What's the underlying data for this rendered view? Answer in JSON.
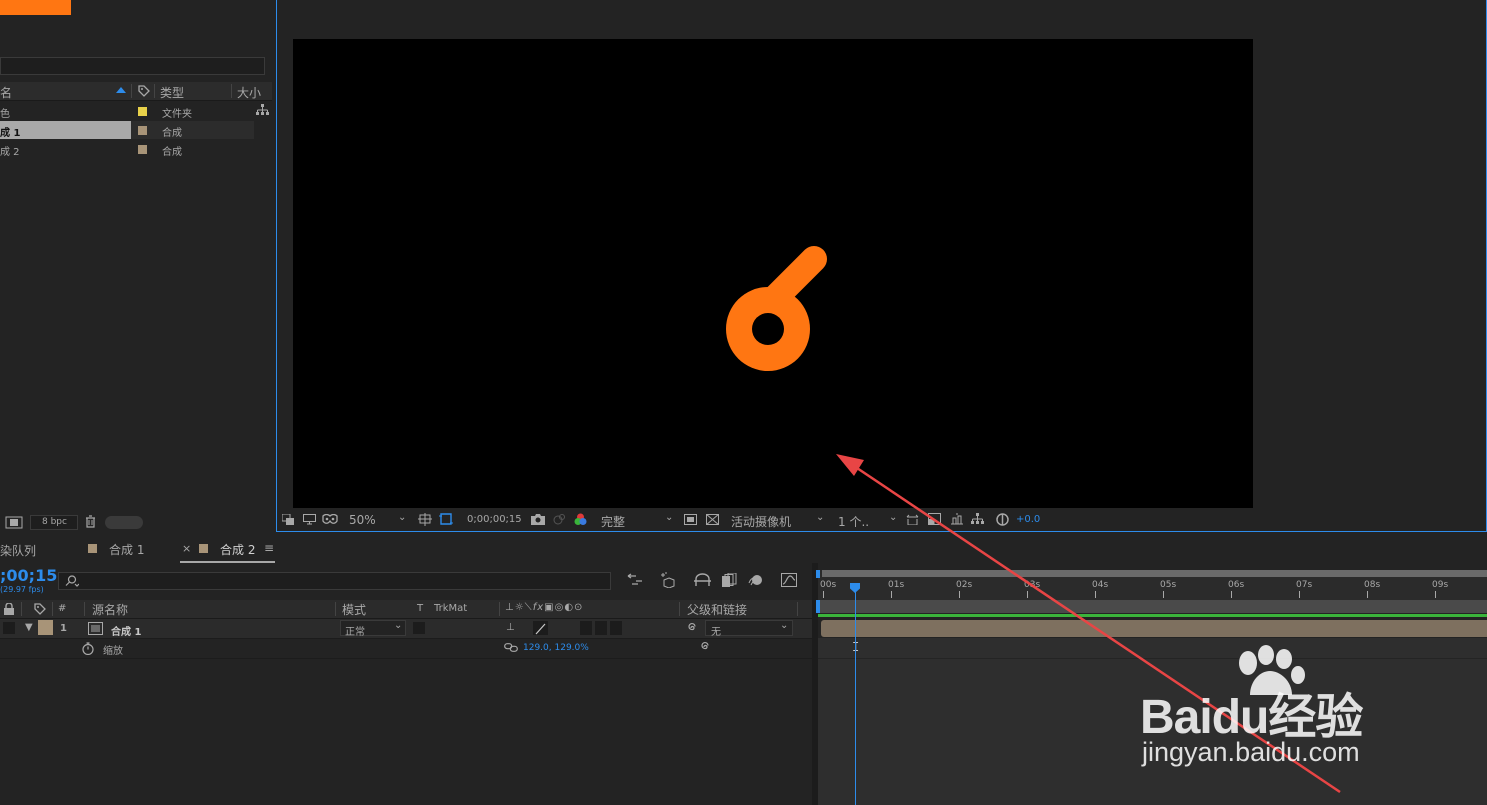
{
  "colors": {
    "accent": "#2d8ceb",
    "orange": "#ff7612",
    "folder": "#e8d14a",
    "comp": "#a89478",
    "green": "#3bb43b"
  },
  "project": {
    "columns": {
      "name": "名",
      "type": "类型",
      "size": "大小"
    },
    "items": [
      {
        "name": "色",
        "type": "文件夹"
      },
      {
        "name": "成 1",
        "type": "合成"
      },
      {
        "name": "成 2",
        "type": "合成"
      }
    ],
    "bpc": "8 bpc"
  },
  "viewer": {
    "zoom": "50%",
    "timecode": "0;00;00;15",
    "resolution": "完整",
    "camera": "活动摄像机",
    "views": "1 个..",
    "exposure": "+0.0"
  },
  "tabs": {
    "render_queue": "染队列",
    "comp1": "合成 1",
    "comp2": "合成 2",
    "close": "×",
    "menu": "≡"
  },
  "timeline": {
    "timecode": ";00;15",
    "fps": "(29.97 fps)",
    "search_placeholder": "",
    "columns": {
      "hash": "#",
      "source_name": "源名称",
      "mode": "模式",
      "t": "T",
      "trkmat": "TrkMat",
      "parent": "父级和链接"
    },
    "layer": {
      "index": "1",
      "name": "合成 1",
      "mode": "正常",
      "parent": "无"
    },
    "property": {
      "name": "缩放",
      "value": "129.0, 129.0%"
    },
    "ruler_labels": [
      "00s",
      "01s",
      "02s",
      "03s",
      "04s",
      "05s",
      "06s",
      "07s",
      "08s",
      "09s"
    ]
  },
  "watermark": {
    "logo": "Baidu经验",
    "url": "jingyan.baidu.com"
  }
}
